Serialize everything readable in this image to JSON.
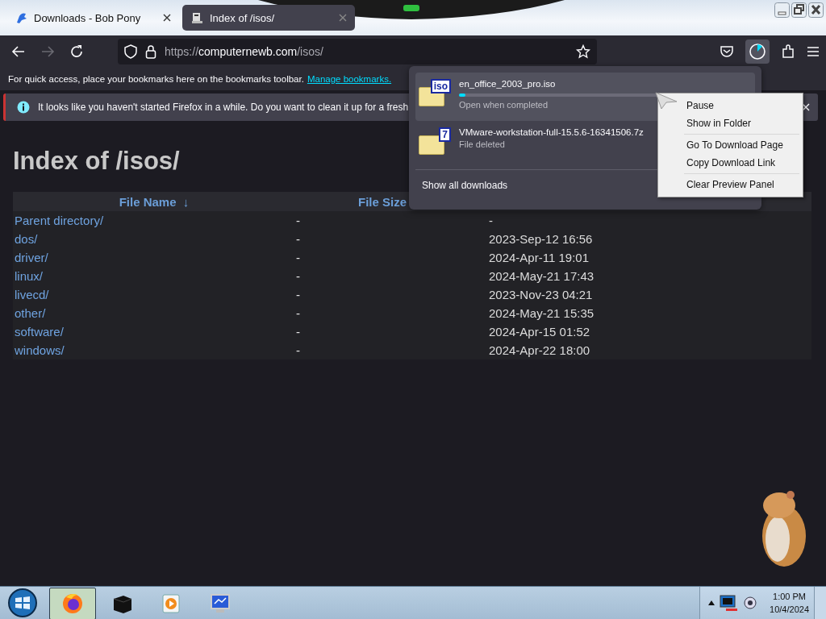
{
  "tabs": [
    {
      "title": "Downloads - Bob Pony",
      "selected": false,
      "kind": "bird"
    },
    {
      "title": "Index of /isos/",
      "selected": true,
      "kind": "server"
    }
  ],
  "toolbar": {
    "forward_disabled": true,
    "url_scheme": "https://",
    "url_host": "computernewb.com",
    "url_path": "/isos/"
  },
  "bookmarks_bar": {
    "text": "For quick access, place your bookmarks here on the bookmarks toolbar.",
    "link": "Manage bookmarks."
  },
  "notification": {
    "text": "It looks like you haven't started Firefox in a while. Do you want to clean it up for a fresh"
  },
  "page": {
    "heading": "Index of /isos/",
    "columns": [
      {
        "label": "File Name",
        "sort_indicator": "↓"
      },
      {
        "label": "File Size"
      }
    ],
    "rows": [
      {
        "name": "Parent directory/",
        "size": "-",
        "date": "-"
      },
      {
        "name": "dos/",
        "size": "-",
        "date": "2023-Sep-12 16:56"
      },
      {
        "name": "driver/",
        "size": "-",
        "date": "2024-Apr-11 19:01"
      },
      {
        "name": "linux/",
        "size": "-",
        "date": "2024-May-21 17:43"
      },
      {
        "name": "livecd/",
        "size": "-",
        "date": "2023-Nov-23 04:21"
      },
      {
        "name": "other/",
        "size": "-",
        "date": "2024-May-21 15:35"
      },
      {
        "name": "software/",
        "size": "-",
        "date": "2024-Apr-15 01:52"
      },
      {
        "name": "windows/",
        "size": "-",
        "date": "2024-Apr-22 18:00"
      }
    ]
  },
  "downloads_panel": {
    "items": [
      {
        "kind": "active",
        "badge": "iso",
        "name": "en_office_2003_pro.iso",
        "status": "Open when completed",
        "level": 0.03,
        "selected": true
      },
      {
        "kind": "deleted",
        "badge": "7",
        "name": "VMware-workstation-full-15.5.6-16341506.7z",
        "status": "File deleted",
        "selected": false
      }
    ],
    "footer": "Show all downloads"
  },
  "context_menu": {
    "groups": [
      {
        "items": [
          {
            "label": "Pause"
          },
          {
            "label": "Show in Folder"
          }
        ]
      },
      {
        "items": [
          {
            "label": "Go To Download Page"
          },
          {
            "label": "Copy Download Link"
          }
        ]
      },
      {
        "items": [
          {
            "label": "Clear Preview Panel"
          }
        ]
      }
    ]
  },
  "taskbar": {
    "buttons": [
      {
        "kind": "firefox",
        "selected": true
      },
      {
        "kind": "cube",
        "selected": false
      },
      {
        "kind": "media",
        "selected": false
      },
      {
        "kind": "monitor",
        "selected": false
      }
    ],
    "clock_time": "1:00 PM",
    "clock_date": "10/4/2024"
  }
}
